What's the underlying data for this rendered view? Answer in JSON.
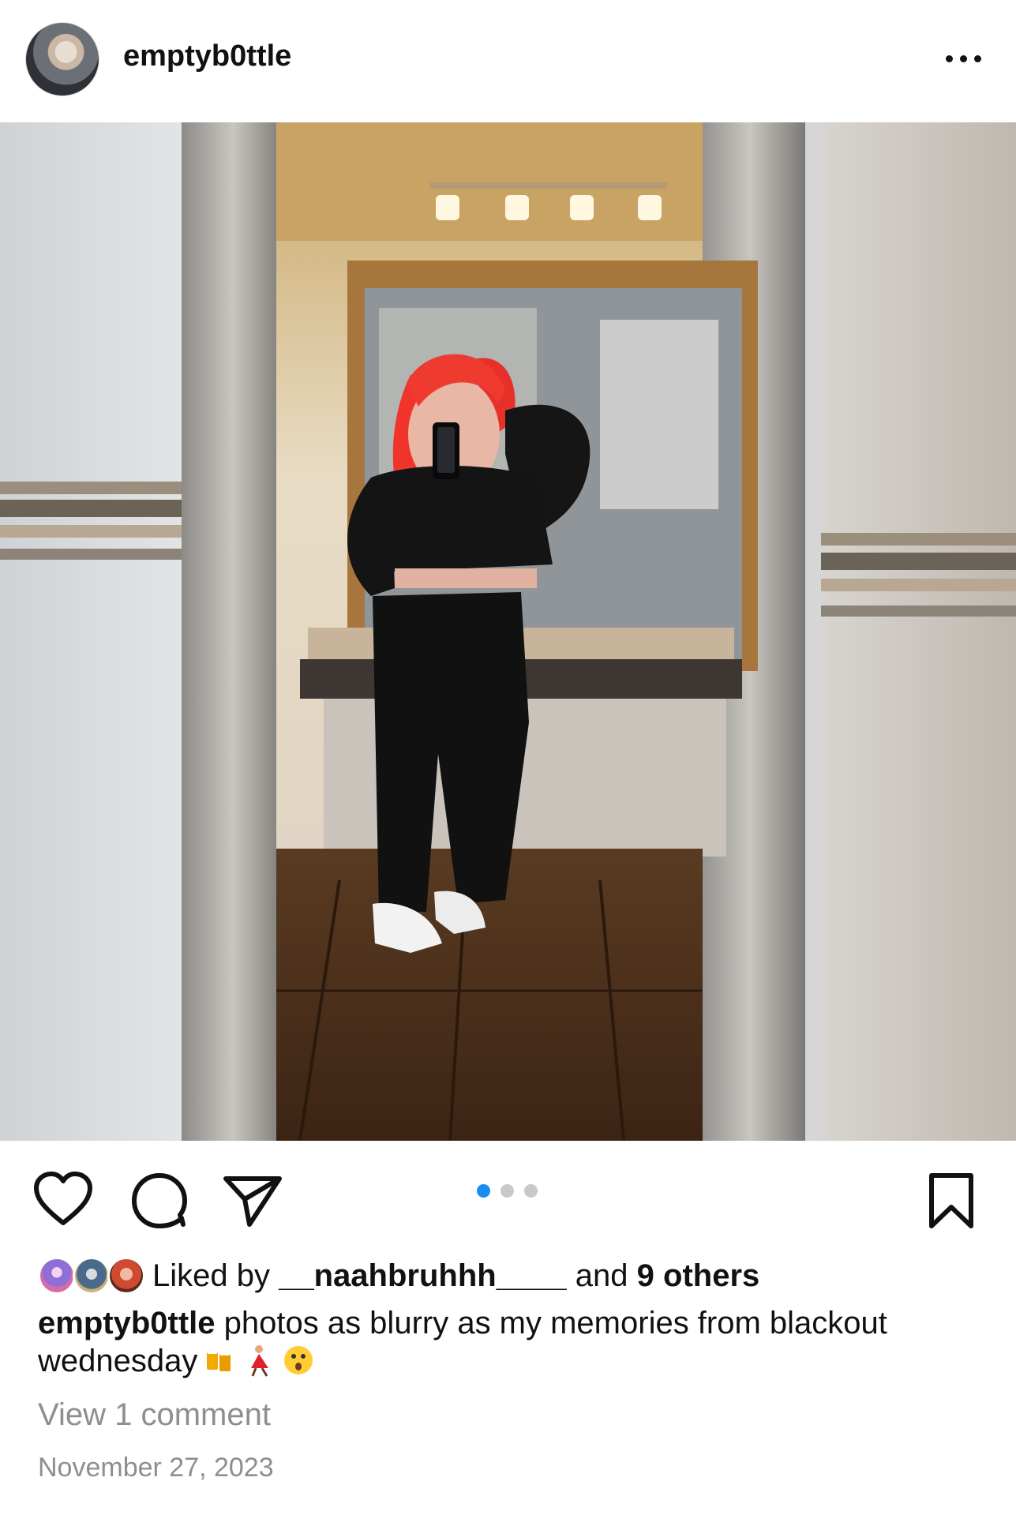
{
  "post": {
    "username": "emptyb0ttle",
    "avatar_icon": "profile-avatar",
    "more_icon": "more-horizontal-icon"
  },
  "media": {
    "description_icon": "photo",
    "carousel": {
      "total": 3,
      "active_index": 0
    },
    "colors": {
      "active_dot": "#1a8cf0",
      "inactive_dot": "#c8c8c8"
    }
  },
  "actions": {
    "like_icon": "heart-icon",
    "comment_icon": "comment-icon",
    "share_icon": "send-icon",
    "save_icon": "bookmark-icon"
  },
  "likes": {
    "prefix": "Liked by ",
    "user": "__naahbruhhh____",
    "middle": " and ",
    "others": "9 others"
  },
  "caption": {
    "username": "emptyb0ttle",
    "text": " photos as blurry as my memories from blackout wednesday",
    "emojis": [
      "beer-mugs-emoji",
      "dancer-emoji",
      "astonished-face-emoji"
    ]
  },
  "comments": {
    "view_label": "View 1 comment"
  },
  "date": "November 27, 2023"
}
